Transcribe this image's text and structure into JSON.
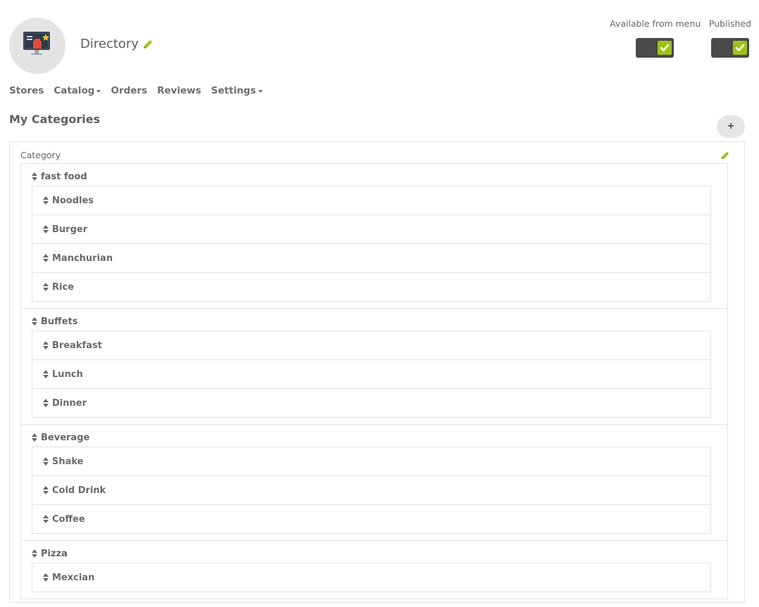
{
  "header": {
    "app_title": "Directory",
    "logo_icon": "directory-app-icon",
    "edit_icon": "pencil-icon"
  },
  "toggles": [
    {
      "label": "Available from menu",
      "checked": true,
      "icon": "check-icon"
    },
    {
      "label": "Published",
      "checked": true,
      "icon": "check-icon"
    }
  ],
  "nav": [
    {
      "label": "Stores",
      "has_dropdown": false
    },
    {
      "label": "Catalog",
      "has_dropdown": true
    },
    {
      "label": "Orders",
      "has_dropdown": false
    },
    {
      "label": "Reviews",
      "has_dropdown": false
    },
    {
      "label": "Settings",
      "has_dropdown": true
    }
  ],
  "section": {
    "title": "My Categories",
    "add_label": "+"
  },
  "panel": {
    "header": "Category",
    "groups": [
      {
        "name": "fast food",
        "items": [
          "Noodles",
          "Burger",
          "Manchurian",
          "Rice"
        ]
      },
      {
        "name": "Buffets",
        "items": [
          "Breakfast",
          "Lunch",
          "Dinner"
        ]
      },
      {
        "name": "Beverage",
        "items": [
          "Shake",
          "Cold Drink",
          "Coffee"
        ]
      },
      {
        "name": "Pizza",
        "items": [
          "Mexcian"
        ]
      }
    ]
  },
  "colors": {
    "accent": "#9cc318",
    "toggle_track": "#4a4a4a",
    "text": "#6b6b6b",
    "border": "#e2e2e2"
  }
}
